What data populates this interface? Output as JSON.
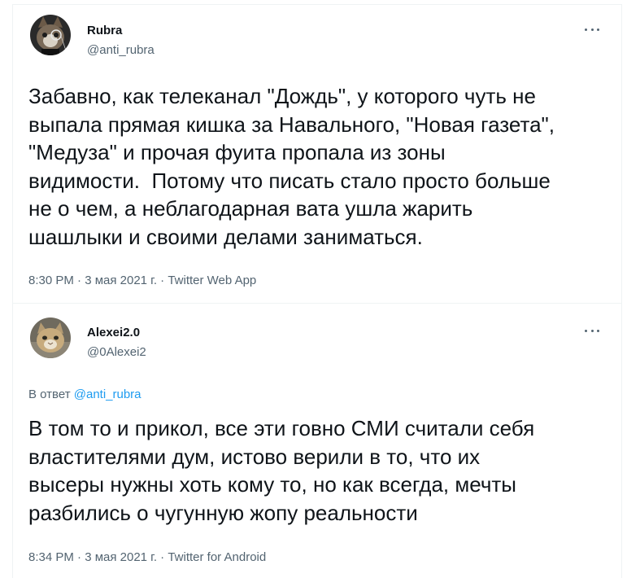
{
  "tweets": [
    {
      "name": "Rubra",
      "handle": "@anti_rubra",
      "avatar_icon": "cat-with-monocle-avatar",
      "text": "Забавно, как телеканал \"Дождь\", у которого чуть не\nвыпала прямая кишка за Навального, \"Новая газета\",\n\"Медуза\" и прочая фуита пропала из зоны\nвидимости.  Потому что писать стало просто больше\nне о чем, а неблагодарная вата ушла жарить\nшашлыки и своими делами заниматься.",
      "meta": "8:30 PM · 3 мая 2021 г. · Twitter Web App"
    },
    {
      "name": "Alexei2.0",
      "handle": "@0Alexei2",
      "avatar_icon": "cat-photo-avatar",
      "reply_prefix": "В ответ ",
      "reply_to": "@anti_rubra",
      "text": "В том то и прикол, все эти говно СМИ считали себя\nвластителями дум, истово верили в то, что их\nвысеры нужны хоть кому то, но как всегда, мечты\nразбились о чугунную жопу реальности",
      "meta": "8:34 PM · 3 мая 2021 г. · Twitter for Android"
    }
  ],
  "colors": {
    "text": "#0f1419",
    "secondary": "#536471",
    "link": "#1d9bf0",
    "divider": "#eff3f4"
  }
}
